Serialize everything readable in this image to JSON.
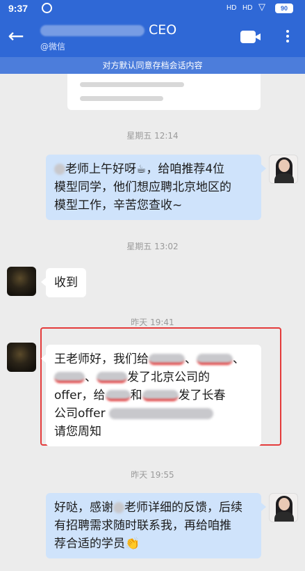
{
  "status_bar": {
    "time": "9:37",
    "signal_1": "HD",
    "signal_2": "HD",
    "battery": "90"
  },
  "header": {
    "title_suffix": "CEO",
    "subtitle": "@微信"
  },
  "notice": "对方默认同意存档会话内容",
  "messages": [
    {
      "time": "星期五 12:14"
    },
    {
      "from": "me",
      "line1": "老师上午好呀",
      "line2": "，给咱推荐4位",
      "line3": "模型同学，他们想应聘北京地区的",
      "line4": "模型工作，辛苦您查收~"
    },
    {
      "time": "星期五 13:02"
    },
    {
      "from": "other",
      "text": "收到"
    },
    {
      "time": "昨天 19:41"
    },
    {
      "from": "other",
      "line1a": "王老师好，我们给",
      "line1b": "、",
      "line1c": "、",
      "line2a": "、",
      "line2b": "发了北京公司的",
      "line3a": "offer，给",
      "line3b": "和",
      "line3c": "发了长春",
      "line4a": "公司offer",
      "line5": "请您周知"
    },
    {
      "time": "昨天 19:55"
    },
    {
      "from": "me",
      "line1a": "好哒，感谢",
      "line1b": "老师详细的反馈，后续",
      "line2": "有招聘需求随时联系我，再给咱推",
      "line3": "荐合适的学员"
    }
  ],
  "colors": {
    "header": "#2f68d6",
    "notice": "#4c7ddb",
    "sent_bubble": "#cfe3fb",
    "highlight": "#e43b3b"
  }
}
